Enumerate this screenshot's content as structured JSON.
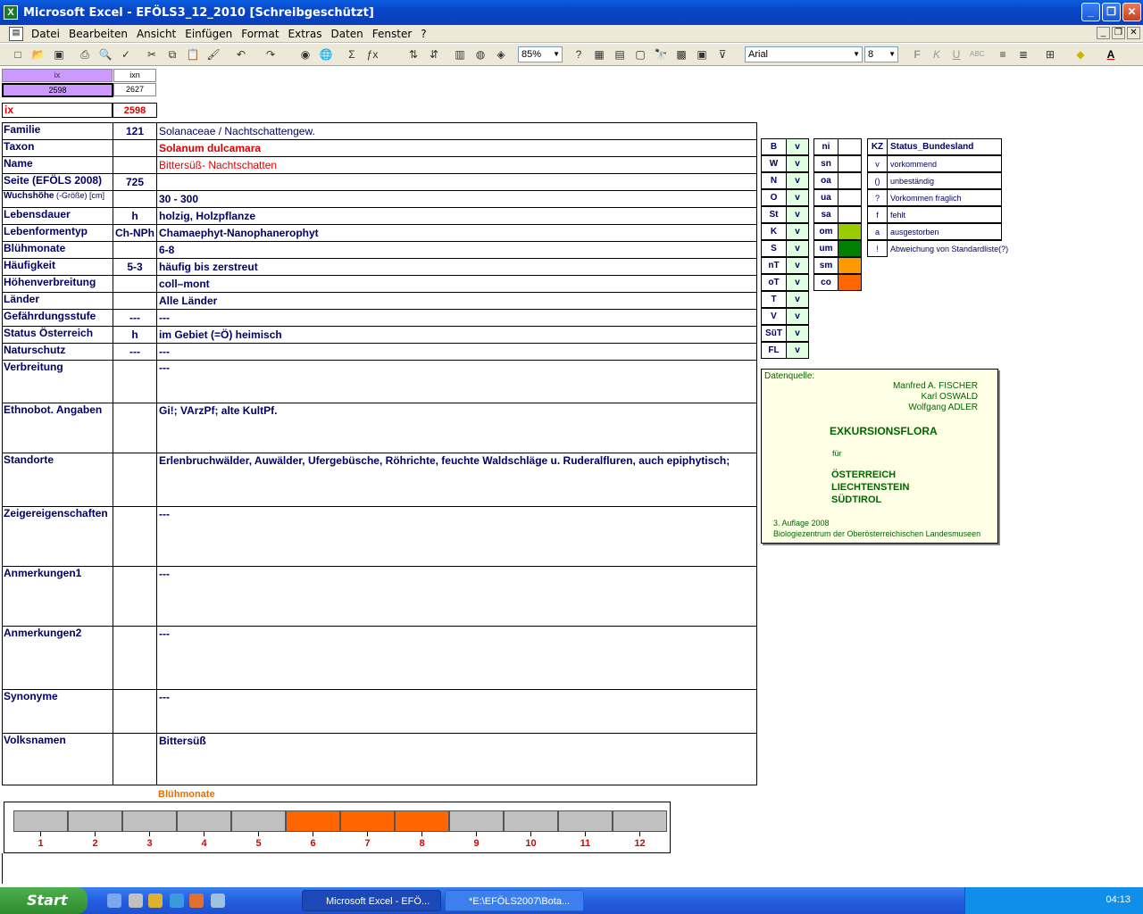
{
  "window": {
    "title": "Microsoft Excel - EFÖLS3_12_2010  [Schreibgeschützt]"
  },
  "menu": [
    "Datei",
    "Bearbeiten",
    "Ansicht",
    "Einfügen",
    "Format",
    "Extras",
    "Daten",
    "Fenster",
    "?"
  ],
  "toolbar": {
    "zoom": "85%",
    "font": "Arial",
    "size": "8"
  },
  "index": {
    "ix_header": "ix",
    "ixn_header": "ixn",
    "ix_value": "2598",
    "ixn_value": "2627",
    "ix_label": "ix",
    "ix_red": "2598"
  },
  "rows": [
    {
      "label": "Familie",
      "code": "121",
      "value": "Solanaceae  /  Nachtschattengew."
    },
    {
      "label": "Taxon",
      "code": "",
      "value": "Solanum dulcamara"
    },
    {
      "label": "Name",
      "code": "",
      "value": "Bittersüß- Nachtschatten"
    },
    {
      "label": "Seite (EFÖLS 2008)",
      "code": "725",
      "value": ""
    },
    {
      "label": "Wuchshöhe",
      "label_small": "(-Größe) [cm]",
      "code": "",
      "value": " 30 - 300"
    },
    {
      "label": "Lebensdauer",
      "code": "h",
      "value": "holzig, Holzpflanze"
    },
    {
      "label": "Lebenformentyp",
      "code": "Ch-NPh",
      "value": "Chamaephyt-Nanophanerophyt"
    },
    {
      "label": "Blühmonate",
      "code": "",
      "value": " 6-8"
    },
    {
      "label": "Häufigkeit",
      "code": "5-3",
      "value": "häufig bis zerstreut"
    },
    {
      "label": "Höhenverbreitung",
      "code": "",
      "value": "coll–mont"
    },
    {
      "label": "Länder",
      "code": "",
      "value": "Alle Länder"
    },
    {
      "label": "Gefährdungsstufe",
      "code": "---",
      "value": "  ---"
    },
    {
      "label": "Status Österreich",
      "code": "h",
      "value": "im Gebiet (=Ö) heimisch"
    },
    {
      "label": "Naturschutz",
      "code": "---",
      "value": "---"
    }
  ],
  "big_rows": [
    {
      "label": "Verbreitung",
      "value": " ---"
    },
    {
      "label": "Ethnobot. Angaben",
      "value": "Gi!; VArzPf; alte KultPf."
    },
    {
      "label": "Standorte",
      "value": "Erlenbruchwälder, Auwälder, Ufergebüsche, Röhrichte, feuchte Waldschläge u. Ruderalfluren, auch epiphytisch;"
    },
    {
      "label": "Zeigereigenschaften",
      "value": "---"
    },
    {
      "label": "Anmerkungen1",
      "value": "---"
    },
    {
      "label": "Anmerkungen2",
      "value": "---"
    },
    {
      "label": "Synonyme",
      "value": "---"
    },
    {
      "label": "Volksnamen",
      "value": "Bittersüß"
    }
  ],
  "states": [
    {
      "k": "B",
      "v": "v"
    },
    {
      "k": "W",
      "v": "v"
    },
    {
      "k": "N",
      "v": "v"
    },
    {
      "k": "O",
      "v": "v"
    },
    {
      "k": "St",
      "v": "v"
    },
    {
      "k": "K",
      "v": "v"
    },
    {
      "k": "S",
      "v": "v"
    },
    {
      "k": "nT",
      "v": "v"
    },
    {
      "k": "oT",
      "v": "v"
    },
    {
      "k": "T",
      "v": "v"
    },
    {
      "k": "V",
      "v": "v"
    },
    {
      "k": "SüT",
      "v": "v"
    },
    {
      "k": "FL",
      "v": "v"
    }
  ],
  "heights": [
    {
      "k": "ni",
      "color": ""
    },
    {
      "k": "sn",
      "color": ""
    },
    {
      "k": "oa",
      "color": ""
    },
    {
      "k": "ua",
      "color": ""
    },
    {
      "k": "sa",
      "color": ""
    },
    {
      "k": "om",
      "color": "#99cc00"
    },
    {
      "k": "um",
      "color": "#008000"
    },
    {
      "k": "sm",
      "color": "#ff9900"
    },
    {
      "k": "co",
      "color": "#ff6600"
    }
  ],
  "legend": {
    "header_kz": "KZ",
    "header_status": "Status_Bundesland",
    "items": [
      {
        "kz": "v",
        "text": "vorkommend"
      },
      {
        "kz": "()",
        "text": "unbeständig"
      },
      {
        "kz": "?",
        "text": "Vorkommen fraglich"
      },
      {
        "kz": "f",
        "text": "fehlt"
      },
      {
        "kz": "a",
        "text": "ausgestorben"
      },
      {
        "kz": "!",
        "text": "Abweichung von Standardliste(?)"
      }
    ]
  },
  "source": {
    "label": "Datenquelle:",
    "authors": [
      "Manfred A. FISCHER",
      "Karl OSWALD",
      "Wolfgang ADLER"
    ],
    "title": "EXKURSIONSFLORA",
    "fuer": "für",
    "countries": [
      "ÖSTERREICH",
      "LIECHTENSTEIN",
      "SÜDTIROL"
    ],
    "edition": "3. Auflage 2008",
    "publisher": "Biologiezentrum der Oberösterreichischen Landesmuseen"
  },
  "chart_data": {
    "type": "bar",
    "title": "Blühmonate",
    "categories": [
      "1",
      "2",
      "3",
      "4",
      "5",
      "6",
      "7",
      "8",
      "9",
      "10",
      "11",
      "12"
    ],
    "values": [
      0,
      0,
      0,
      0,
      0,
      1,
      1,
      1,
      0,
      0,
      0,
      0
    ],
    "active_color": "#ff6600",
    "inactive_color": "#c0c0c0"
  },
  "taskbar": {
    "start": "Start",
    "tasks": [
      "Microsoft Excel - EFÖ...",
      "*E:\\EFÖLS2007\\Bota..."
    ],
    "clock": "04:13"
  }
}
